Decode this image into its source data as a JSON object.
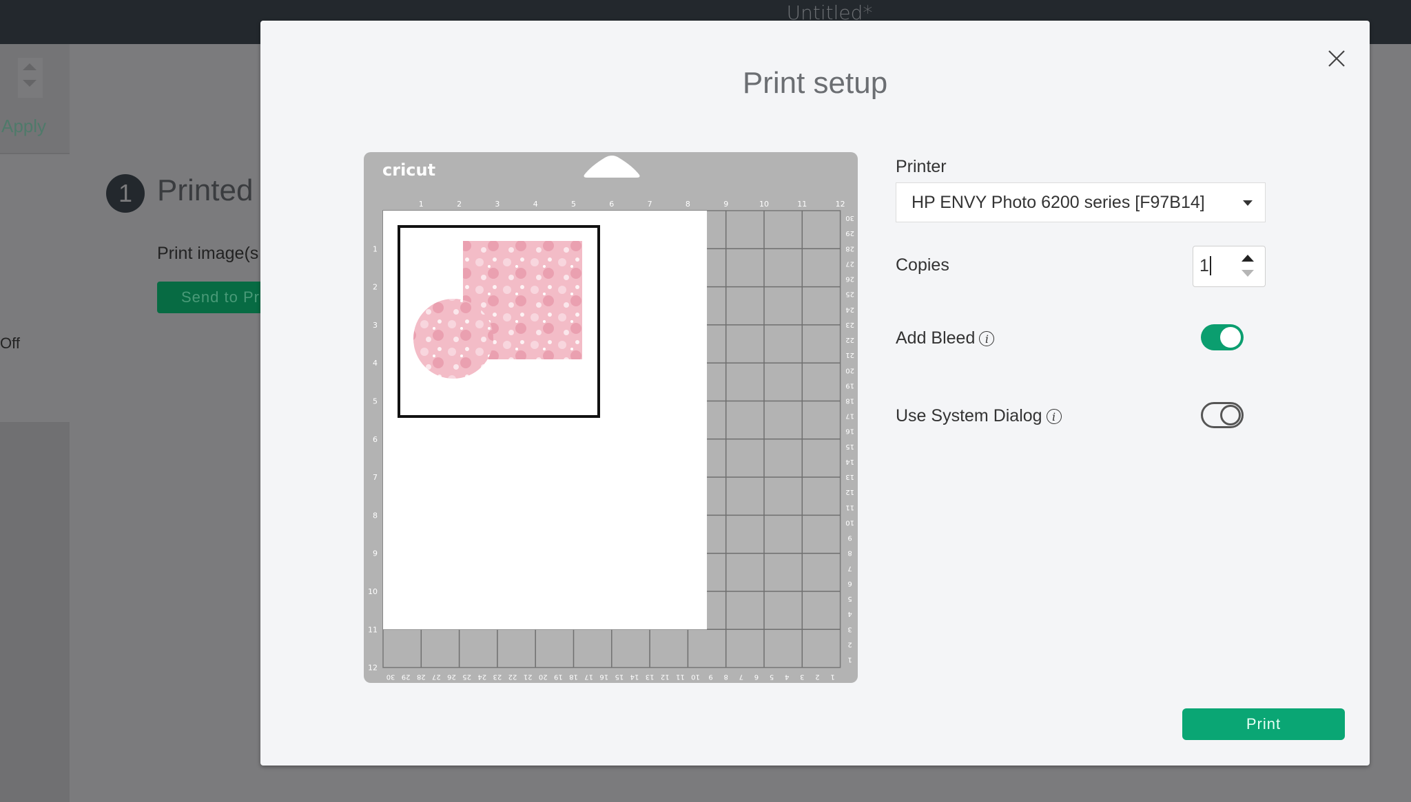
{
  "app": {
    "document_title": "Untitled*"
  },
  "background": {
    "apply_label": "Apply",
    "off_label": "Off",
    "step_number": "1",
    "step_title": "Printed",
    "print_images_label": "Print image(s",
    "send_button_label": "Send to Pr"
  },
  "modal": {
    "title": "Print setup",
    "close_icon": "close-icon",
    "mat": {
      "brand": "cricut",
      "top_ruler": [
        "1",
        "2",
        "3",
        "4",
        "5",
        "6",
        "7",
        "8",
        "9",
        "10",
        "11",
        "12"
      ],
      "left_ruler": [
        "1",
        "2",
        "3",
        "4",
        "5",
        "6",
        "7",
        "8",
        "9",
        "10",
        "11",
        "12"
      ],
      "right_ruler": [
        "30",
        "29",
        "28",
        "27",
        "26",
        "25",
        "24",
        "23",
        "22",
        "21",
        "20",
        "19",
        "18",
        "17",
        "16",
        "15",
        "14",
        "13",
        "12",
        "11",
        "10",
        "9",
        "8",
        "7",
        "6",
        "5",
        "4",
        "3",
        "2",
        "1"
      ],
      "bottom_ruler": [
        "30",
        "29",
        "28",
        "27",
        "26",
        "25",
        "24",
        "23",
        "22",
        "21",
        "20",
        "19",
        "18",
        "17",
        "16",
        "15",
        "14",
        "13",
        "12",
        "11",
        "10",
        "9",
        "8",
        "7",
        "6",
        "5",
        "4",
        "3",
        "2",
        "1"
      ],
      "paper_size_in": [
        8.5,
        11
      ],
      "design_colors": {
        "pink": "#f2b8c4",
        "pink_dark": "#e99aaa"
      }
    },
    "printer": {
      "label": "Printer",
      "value": "HP ENVY Photo 6200 series [F97B14]"
    },
    "copies": {
      "label": "Copies",
      "value": "1"
    },
    "add_bleed": {
      "label": "Add Bleed",
      "info_icon": "info-icon",
      "enabled": true
    },
    "system_dialog": {
      "label": "Use System Dialog",
      "info_icon": "info-icon",
      "enabled": false
    },
    "print_button_label": "Print",
    "accent_color": "#0aa674"
  }
}
